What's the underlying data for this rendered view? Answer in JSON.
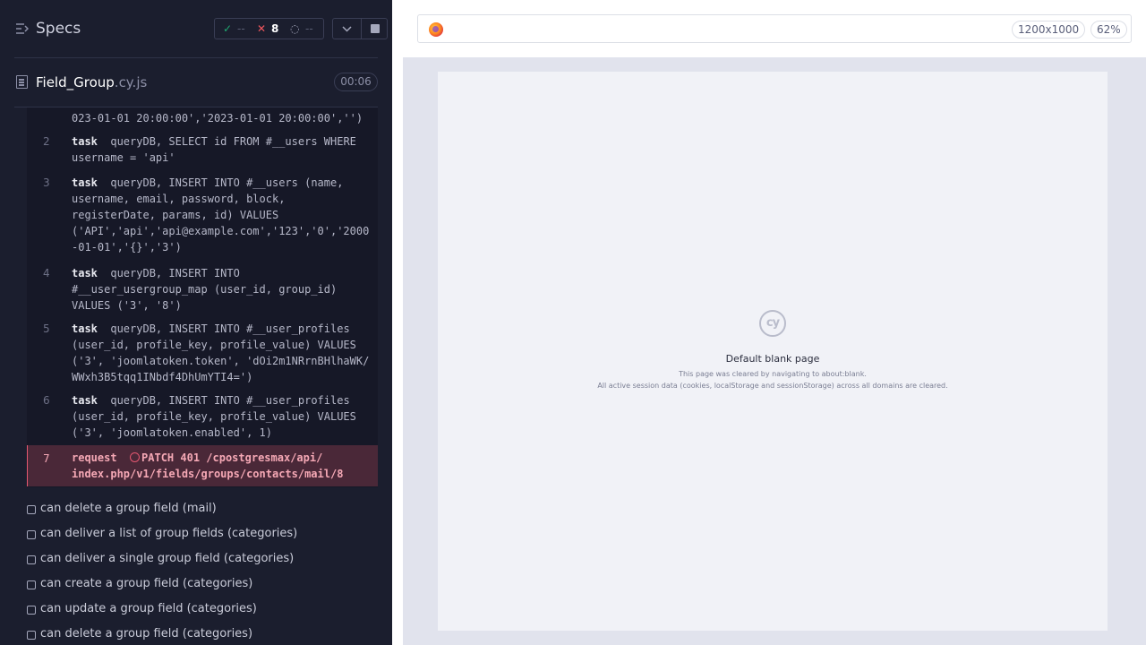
{
  "reporter": {
    "title": "Specs",
    "stats": {
      "passed_icon": "check-icon",
      "passed": "--",
      "failed_icon": "x-icon",
      "failed": "8",
      "pending_icon": "spinner-icon",
      "pending": "--"
    },
    "spec": {
      "file_name": "Field_Group",
      "file_ext": ".cy.js",
      "duration": "00:06"
    },
    "commands": [
      {
        "number": "",
        "name": "",
        "message": "023-01-01 20:00:00','2023-01-01 20:00:00','')"
      },
      {
        "number": "2",
        "name": "task",
        "message": "queryDB, SELECT id FROM #__users WHERE\nusername = 'api'"
      },
      {
        "number": "3",
        "name": "task",
        "message": "queryDB, INSERT INTO #__users (name,\nusername, email, password, block,\nregisterDate, params, id) VALUES\n('API','api','api@example.com','123','0','2000\n-01-01','{}','3')"
      },
      {
        "number": "4",
        "name": "task",
        "message": "queryDB, INSERT INTO\n#__user_usergroup_map (user_id, group_id)\nVALUES ('3', '8')"
      },
      {
        "number": "5",
        "name": "task",
        "message": "queryDB, INSERT INTO #__user_profiles\n(user_id, profile_key, profile_value) VALUES\n('3', 'joomlatoken.token', 'dOi2m1NRrnBHlhaWK/\nWWxh3B5tqq1INbdf4DhUmYTI4=')"
      },
      {
        "number": "6",
        "name": "task",
        "message": "queryDB, INSERT INTO #__user_profiles\n(user_id, profile_key, profile_value) VALUES\n('3', 'joomlatoken.enabled', 1)"
      },
      {
        "number": "7",
        "name": "request",
        "message": "PATCH 401 /cpostgresmax/api/\nindex.php/v1/fields/groups/contacts/mail/8"
      }
    ],
    "tests": [
      "can delete a group field (mail)",
      "can deliver a list of group fields (categories)",
      "can deliver a single group field (categories)",
      "can create a group field (categories)",
      "can update a group field (categories)",
      "can delete a group field (categories)"
    ]
  },
  "aut": {
    "browser_icon": "firefox-icon",
    "viewport": "1200x1000",
    "zoom": "62%",
    "blank": {
      "logo": "cy",
      "title": "Default blank page",
      "line1": "This page was cleared by navigating to about:blank.",
      "line2": "All active session data (cookies, localStorage and sessionStorage) across all domains are cleared."
    }
  }
}
